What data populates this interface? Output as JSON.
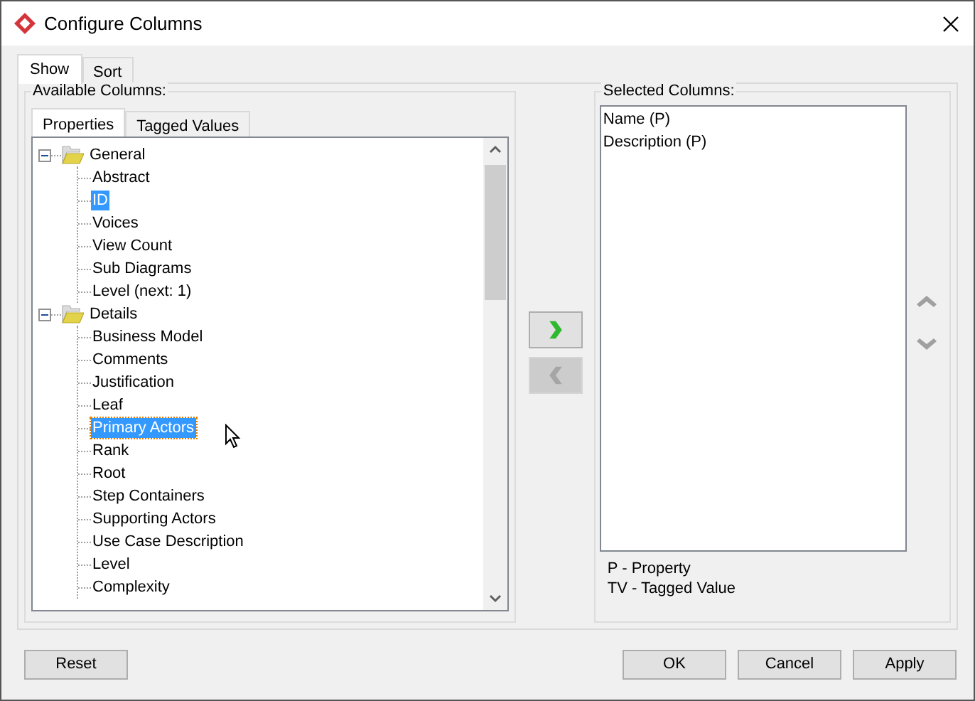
{
  "window": {
    "title": "Configure Columns"
  },
  "tabs": [
    {
      "label": "Show",
      "selected": true
    },
    {
      "label": "Sort",
      "selected": false
    }
  ],
  "available_columns": {
    "title": "Available Columns:",
    "tabs": [
      {
        "label": "Properties",
        "selected": true
      },
      {
        "label": "Tagged Values",
        "selected": false
      }
    ],
    "tree": [
      {
        "label": "General",
        "expanded": true,
        "children": [
          {
            "label": "Abstract",
            "selected": false,
            "focused": false
          },
          {
            "label": "ID",
            "selected": true,
            "focused": false
          },
          {
            "label": "Voices",
            "selected": false,
            "focused": false
          },
          {
            "label": "View Count",
            "selected": false,
            "focused": false
          },
          {
            "label": "Sub Diagrams",
            "selected": false,
            "focused": false
          },
          {
            "label": "Level (next: 1)",
            "selected": false,
            "focused": false
          }
        ]
      },
      {
        "label": "Details",
        "expanded": true,
        "children": [
          {
            "label": "Business Model",
            "selected": false,
            "focused": false
          },
          {
            "label": "Comments",
            "selected": false,
            "focused": false
          },
          {
            "label": "Justification",
            "selected": false,
            "focused": false
          },
          {
            "label": "Leaf",
            "selected": false,
            "focused": false
          },
          {
            "label": "Primary Actors",
            "selected": true,
            "focused": true
          },
          {
            "label": "Rank",
            "selected": false,
            "focused": false
          },
          {
            "label": "Root",
            "selected": false,
            "focused": false
          },
          {
            "label": "Step Containers",
            "selected": false,
            "focused": false
          },
          {
            "label": "Supporting Actors",
            "selected": false,
            "focused": false
          },
          {
            "label": "Use Case Description",
            "selected": false,
            "focused": false
          },
          {
            "label": "Level",
            "selected": false,
            "focused": false
          },
          {
            "label": "Complexity",
            "selected": false,
            "focused": false
          }
        ]
      }
    ]
  },
  "transfer_buttons": [
    {
      "kind": "add",
      "disabled": false
    },
    {
      "kind": "remove",
      "disabled": true
    }
  ],
  "selected_columns": {
    "title": "Selected Columns:",
    "items": [
      "Name (P)",
      "Description (P)"
    ]
  },
  "legend": [
    "P - Property",
    "TV - Tagged Value"
  ],
  "buttons": [
    {
      "label": "Reset"
    },
    {
      "label": "OK"
    },
    {
      "label": "Cancel"
    },
    {
      "label": "Apply"
    }
  ]
}
